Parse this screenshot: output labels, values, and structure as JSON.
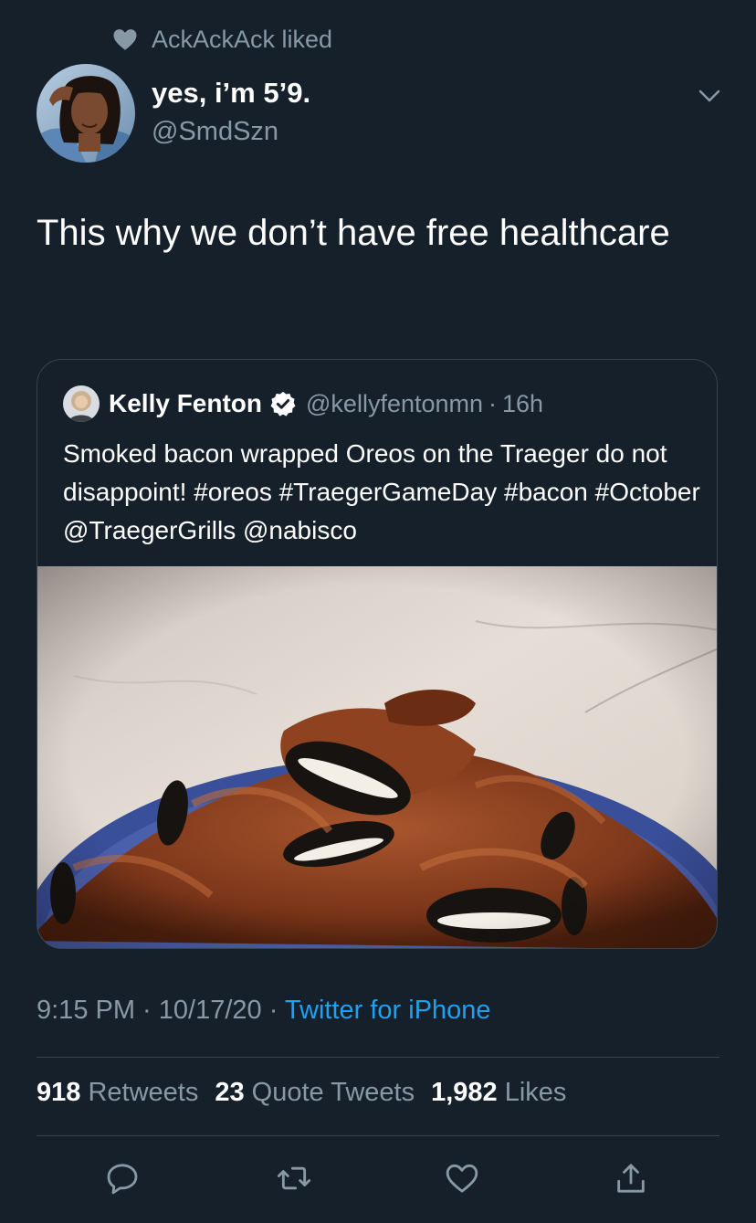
{
  "social_context": {
    "text": "AckAckAck liked",
    "icon": "heart-filled-icon"
  },
  "tweet": {
    "author_name": "yes, i’m 5’9.",
    "author_handle": "@SmdSzn",
    "text": "This why we don’t have free healthcare",
    "timestamp": "9:15 PM · 10/17/20",
    "meta_separator": " · ",
    "source": "Twitter for iPhone",
    "stats": {
      "retweets_count": "918",
      "retweets_label": "Retweets",
      "quotes_count": "23",
      "quotes_label": "Quote Tweets",
      "likes_count": "1,982",
      "likes_label": "Likes"
    }
  },
  "quoted_tweet": {
    "author_name": "Kelly Fenton",
    "verified": true,
    "author_handle": "@kellyfentonmn",
    "separator": "·",
    "time": "16h",
    "text": "Smoked bacon wrapped Oreos on the Traeger do not disappoint! #oreos #TraegerGameDay #bacon #October @TraegerGrills @nabisco"
  },
  "actions": [
    "reply-icon",
    "retweet-icon",
    "like-icon",
    "share-icon"
  ],
  "colors": {
    "background": "#15202b",
    "secondary_text": "#8899a6",
    "accent": "#1da1f2",
    "border": "#38444d"
  }
}
